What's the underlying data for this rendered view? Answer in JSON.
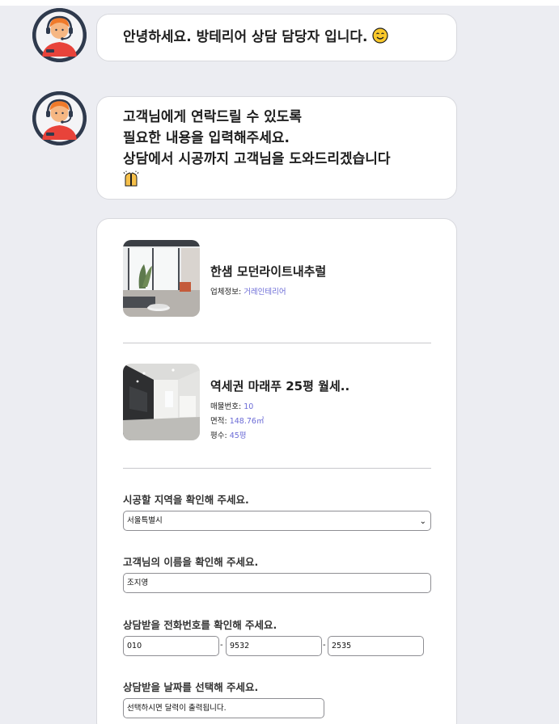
{
  "chat": {
    "greeting": "안녕하세요. 방테리어 상담 담당자 입니다.",
    "greeting_emoji": "smiling-face-icon",
    "intro_lines": [
      "고객님에게 연락드릴 수 있도록",
      "필요한 내용을 입력해주세요.",
      "상담에서 시공까지 고객님을 도와드리겠습니다"
    ],
    "intro_emoji": "raising-hands-icon"
  },
  "listings": [
    {
      "title": "한샘 모던라이트내추럴",
      "meta": [
        {
          "label": "업체정보: ",
          "value": "거레인테리어"
        }
      ]
    },
    {
      "title": "역세권 마래푸 25평 월세..",
      "meta": [
        {
          "label": "매물번호: ",
          "value": "10"
        },
        {
          "label": "면적: ",
          "value": "148.76㎡"
        },
        {
          "label": "평수: ",
          "value": "45평"
        }
      ]
    }
  ],
  "form": {
    "region_label": "시공할 지역을 확인해 주세요.",
    "region_value": "서울특별시",
    "name_label": "고객님의 이름을 확인해 주세요.",
    "name_value": "조지영",
    "phone_label": "상담받을 전화번호를 확인해 주세요.",
    "phone_parts": [
      "010",
      "9532",
      "2535"
    ],
    "phone_sep": "-",
    "date_label": "상담받을 날짜를 선택해 주세요.",
    "date_placeholder": "선택하시면 달력이 출력됩니다."
  },
  "colors": {
    "background": "#ecedf2",
    "accent_text": "#6b6bd6",
    "avatar_bg": "#2f3a4d"
  }
}
